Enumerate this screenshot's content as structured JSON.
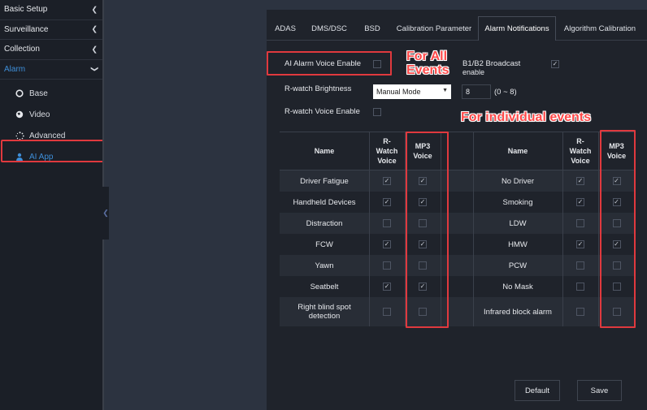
{
  "sidebar": {
    "items": [
      {
        "label": "Basic Setup"
      },
      {
        "label": "Surveillance"
      },
      {
        "label": "Collection"
      },
      {
        "label": "Alarm"
      }
    ],
    "subitems": [
      {
        "label": "Base",
        "icon": "circle-icon"
      },
      {
        "label": "Video",
        "icon": "globe-icon"
      },
      {
        "label": "Advanced",
        "icon": "spinner-icon"
      },
      {
        "label": "AI App",
        "icon": "person-icon"
      }
    ]
  },
  "tabs": [
    "ADAS",
    "DMS/DSC",
    "BSD",
    "Calibration Parameter",
    "Alarm Notifications",
    "Algorithm Calibration"
  ],
  "active_tab": "Alarm Notifications",
  "settings": {
    "ai_alarm_voice_enable_label": "AI Alarm Voice Enable",
    "b1b2_broadcast_label_line1": "B1/B2 Broadcast",
    "b1b2_broadcast_label_line2": "enable",
    "rwatch_brightness_label": "R-watch Brightness",
    "brightness_mode_value": "Manual Mode",
    "brightness_level_value": "8",
    "brightness_range": "(0 ~ 8)",
    "rwatch_voice_enable_label": "R-watch Voice Enable"
  },
  "annotations": {
    "for_all_line1": "For All",
    "for_all_line2": "Events",
    "for_individual": "For individual events"
  },
  "table": {
    "headers": {
      "name": "Name",
      "rwatch_line1": "R-",
      "rwatch_line2": "Watch",
      "rwatch_line3": "Voice",
      "mp3_line1": "MP3",
      "mp3_line2": "Voice"
    },
    "left_rows": [
      {
        "name": "Driver Fatigue",
        "rwatch": true,
        "mp3": true
      },
      {
        "name": "Handheld Devices",
        "rwatch": true,
        "mp3": true
      },
      {
        "name": "Distraction",
        "rwatch": false,
        "mp3": false
      },
      {
        "name": "FCW",
        "rwatch": true,
        "mp3": true
      },
      {
        "name": "Yawn",
        "rwatch": false,
        "mp3": false
      },
      {
        "name": "Seatbelt",
        "rwatch": true,
        "mp3": true
      },
      {
        "name": "Right blind spot detection",
        "rwatch": false,
        "mp3": false
      }
    ],
    "right_rows": [
      {
        "name": "No Driver",
        "rwatch": true,
        "mp3": true
      },
      {
        "name": "Smoking",
        "rwatch": true,
        "mp3": true
      },
      {
        "name": "LDW",
        "rwatch": false,
        "mp3": false
      },
      {
        "name": "HMW",
        "rwatch": true,
        "mp3": true
      },
      {
        "name": "PCW",
        "rwatch": false,
        "mp3": false
      },
      {
        "name": "No Mask",
        "rwatch": false,
        "mp3": false
      },
      {
        "name": "Infrared block alarm",
        "rwatch": false,
        "mp3": false
      }
    ]
  },
  "buttons": {
    "default_label": "Default",
    "save_label": "Save"
  },
  "colors": {
    "accent": "#3e8ed8",
    "annotation_red": "#e0393e"
  }
}
